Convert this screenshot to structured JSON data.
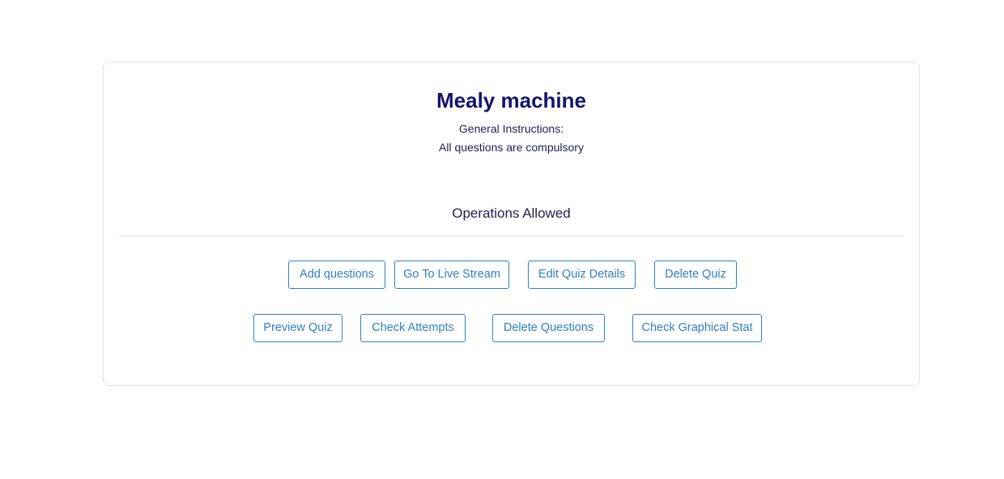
{
  "quiz": {
    "title": "Mealy machine",
    "instructions_label": "General Instructions:",
    "instructions_text": "All questions are compulsory"
  },
  "operations": {
    "heading": "Operations Allowed",
    "row1": {
      "add_questions": "Add questions",
      "live_stream": "Go To Live Stream",
      "edit_details": "Edit Quiz Details",
      "delete_quiz": "Delete Quiz"
    },
    "row2": {
      "preview_quiz": "Preview Quiz",
      "check_attempts": "Check Attempts",
      "delete_questions": "Delete Questions",
      "graphical_stat": "Check Graphical Stat"
    }
  },
  "colors": {
    "title": "#14146b",
    "accent": "#2f7fc7",
    "border": "#e3e3e3"
  }
}
